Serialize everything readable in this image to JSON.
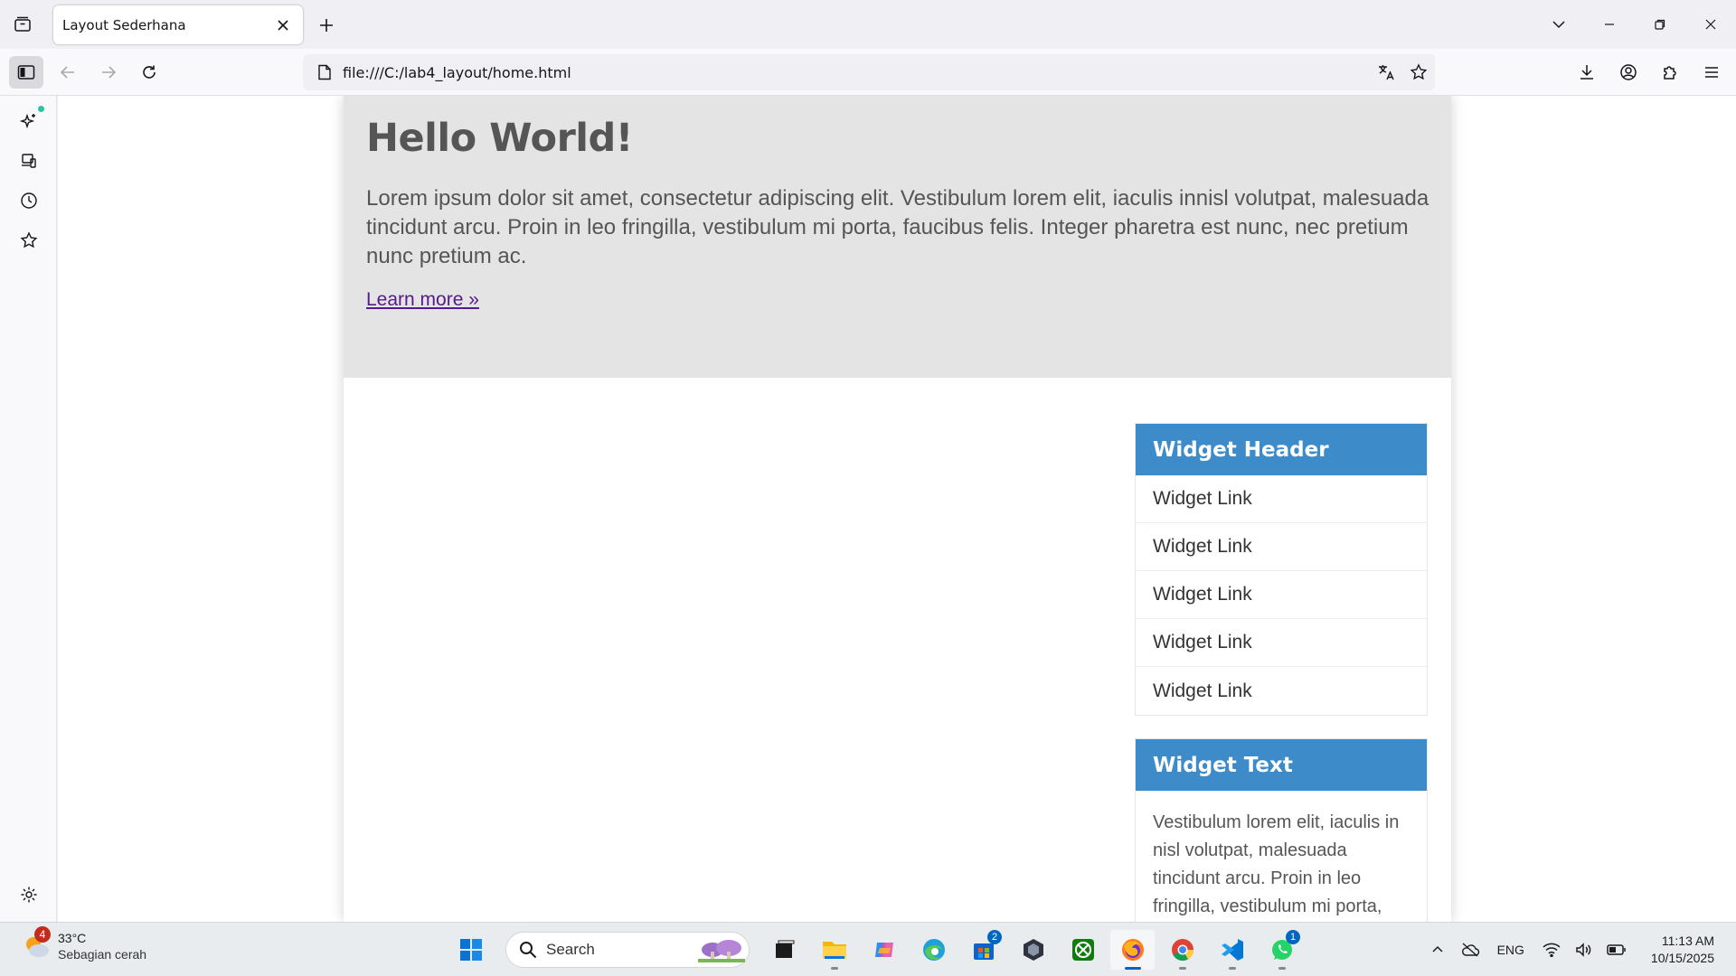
{
  "browser": {
    "tab_title": "Layout Sederhana",
    "url": "file:///C:/lab4_layout/home.html"
  },
  "page": {
    "heading": "Hello World!",
    "lead": "Lorem ipsum dolor sit amet, consectetur adipiscing elit. Vestibulum lorem elit, iaculis innisl volutpat, malesuada tincidunt arcu. Proin in leo fringilla, vestibulum mi porta, faucibus felis. Integer pharetra est nunc, nec pretium nunc pretium ac.",
    "learn_more": "Learn more »",
    "widget1": {
      "header": "Widget Header",
      "links": [
        "Widget Link",
        "Widget Link",
        "Widget Link",
        "Widget Link",
        "Widget Link"
      ]
    },
    "widget2": {
      "header": "Widget Text",
      "text": "Vestibulum lorem elit, iaculis in nisl volutpat, malesuada tincidunt arcu. Proin in leo fringilla, vestibulum mi porta,"
    }
  },
  "colors": {
    "widget_header": "#3e8bc9",
    "hero_bg": "#e4e4e4",
    "link_visited": "#551a8b"
  },
  "taskbar": {
    "weather_badge": "4",
    "temperature": "33°C",
    "condition": "Sebagian cerah",
    "search_label": "Search",
    "store_badge": "2",
    "whatsapp_badge": "1",
    "language": "ENG",
    "time": "11:13 AM",
    "date": "10/15/2025"
  }
}
